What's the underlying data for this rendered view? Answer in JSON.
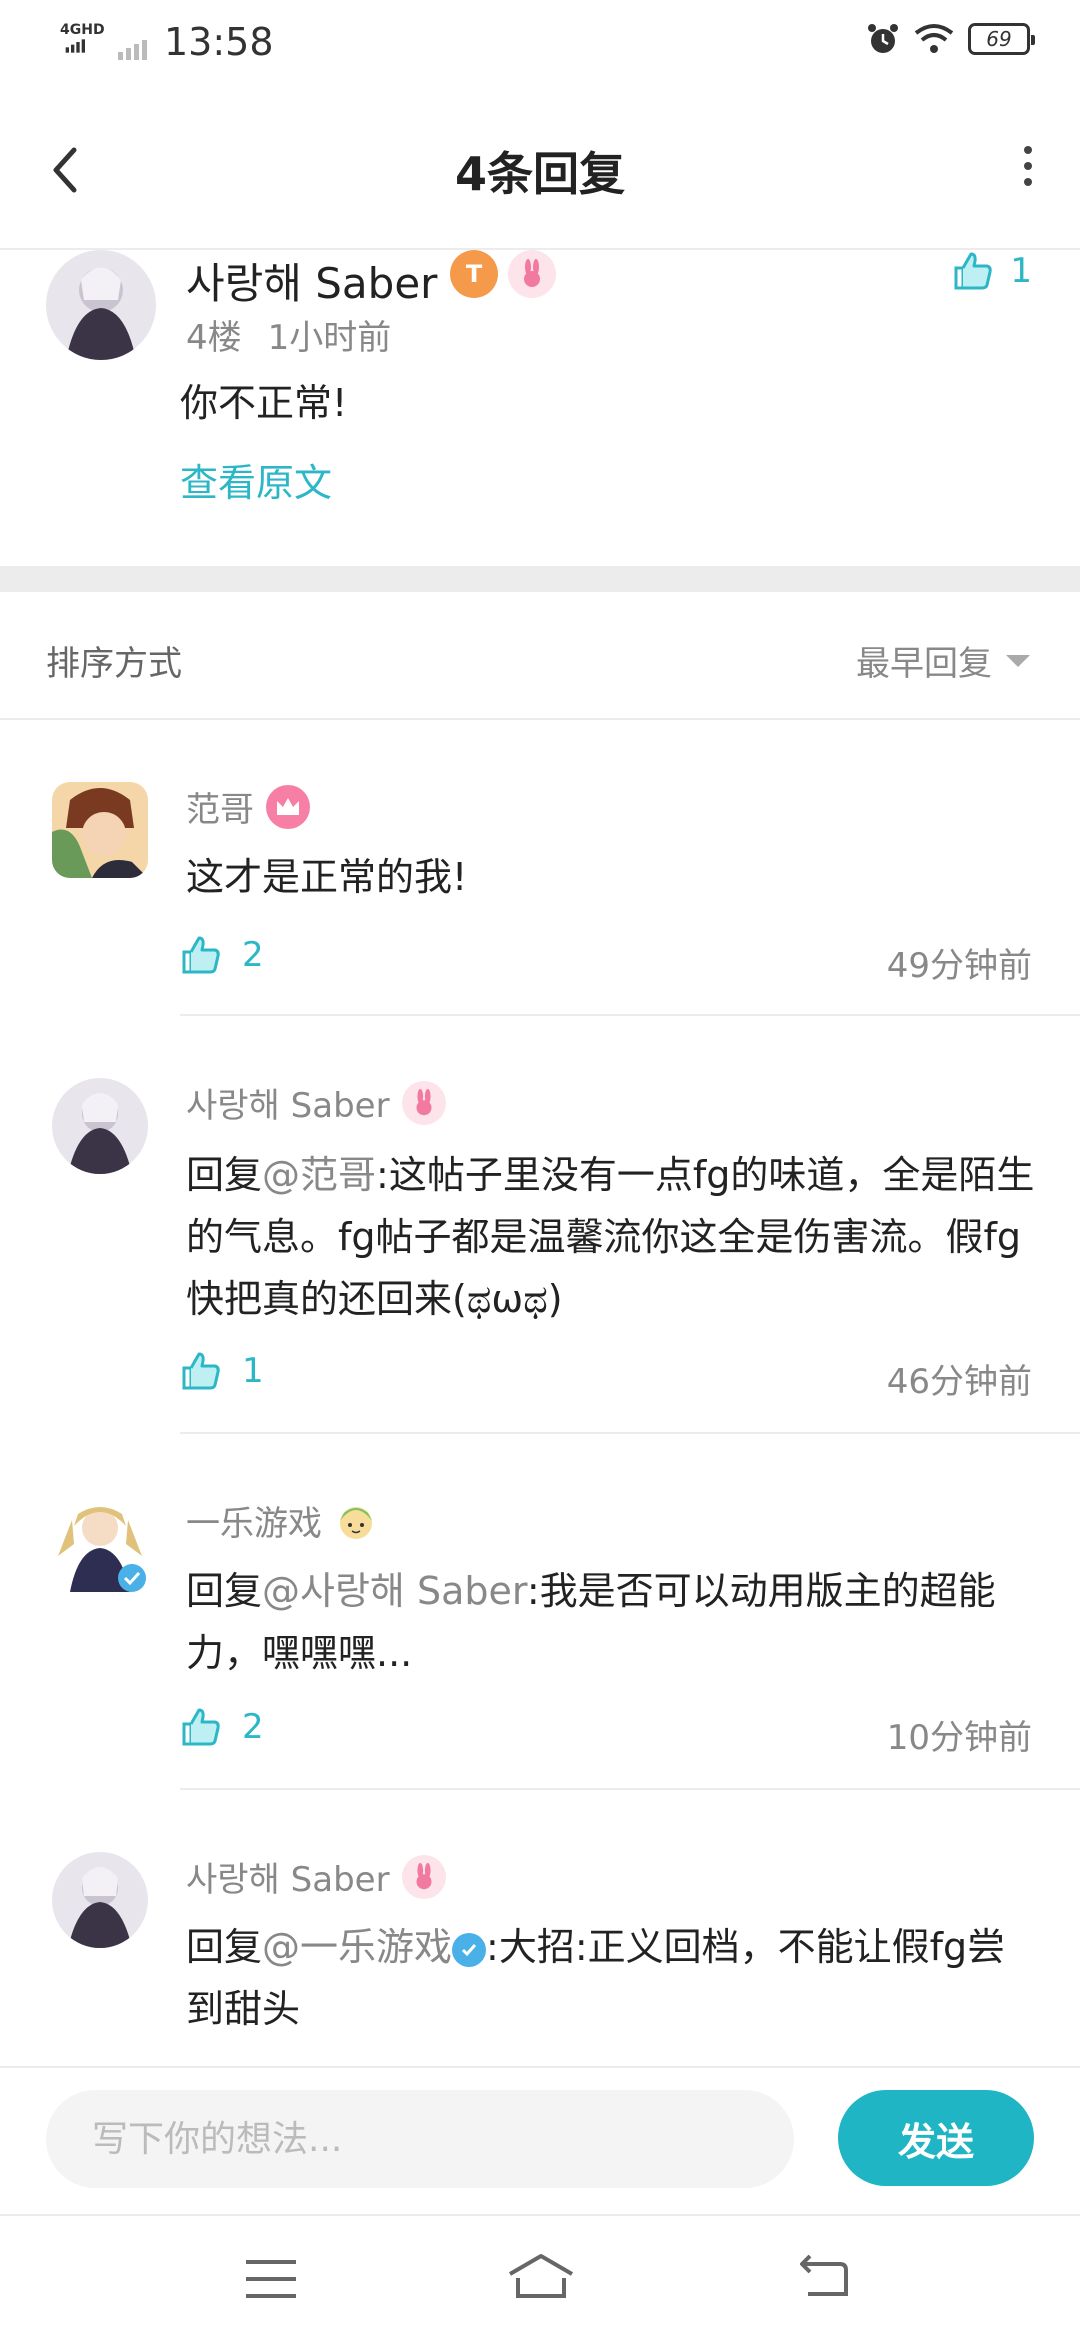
{
  "status_bar": {
    "network": "4GHD",
    "time": "13:58",
    "battery": "69"
  },
  "header": {
    "title": "4条回复"
  },
  "original_comment": {
    "author": "사랑해 Saber",
    "badge_level": "T",
    "floor": "4楼",
    "time": "1小时前",
    "text": "你不正常!",
    "like_count": "1",
    "view_original": "查看原文"
  },
  "sort": {
    "label": "排序方式",
    "value": "最早回复"
  },
  "replies": [
    {
      "author": "范哥",
      "text": "这才是正常的我!",
      "likes": "2",
      "time": "49分钟前"
    },
    {
      "author": "사랑해 Saber",
      "reply_prefix": "回复",
      "mention": "@范哥",
      "text": ":这帖子里没有一点fg的味道，全是陌生的气息。fg帖子都是温馨流你这全是伤害流。假fg快把真的还回来(ಥωಥ)",
      "likes": "1",
      "time": "46分钟前"
    },
    {
      "author": "一乐游戏",
      "reply_prefix": "回复",
      "mention": "@사랑해 Saber",
      "text": ":我是否可以动用版主的超能力，嘿嘿嘿...",
      "likes": "2",
      "time": "10分钟前"
    },
    {
      "author": "사랑해 Saber",
      "reply_prefix": "回复",
      "mention": "@一乐游戏",
      "text": ":大招:正义回档，不能让假fg尝到甜头"
    }
  ],
  "input_bar": {
    "placeholder": "写下你的想法...",
    "send_label": "发送"
  },
  "colors": {
    "accent": "#1fb5c4",
    "text_muted": "#888888",
    "divider": "#ececec"
  }
}
